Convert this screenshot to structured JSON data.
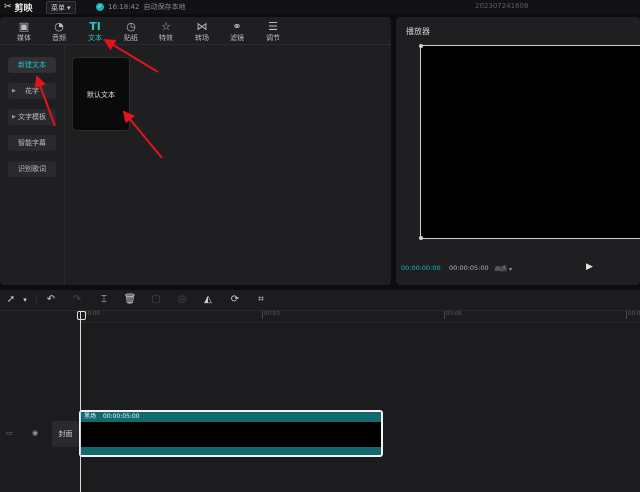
{
  "topbar": {
    "app_name": "剪映",
    "menu_label": "菜单",
    "save_time": "16:18:42",
    "save_text": "自动保存本地",
    "project_title": "202307241608"
  },
  "tabs": [
    {
      "label": "媒体",
      "icon": "media-icon"
    },
    {
      "label": "音频",
      "icon": "audio-icon"
    },
    {
      "label": "文本",
      "icon": "text-icon"
    },
    {
      "label": "贴纸",
      "icon": "sticker-icon"
    },
    {
      "label": "特效",
      "icon": "effects-icon"
    },
    {
      "label": "转场",
      "icon": "transition-icon"
    },
    {
      "label": "滤镜",
      "icon": "filter-icon"
    },
    {
      "label": "调节",
      "icon": "adjust-icon"
    }
  ],
  "text_menu": {
    "new_text": "新建文本",
    "fancy_text": "花字",
    "text_template": "文字模板",
    "smart_subtitle": "智能字幕",
    "lyrics": "识别歌词"
  },
  "default_text_card": "默认文本",
  "player": {
    "title": "播放器",
    "current_time": "00:00:00:00",
    "total_time": "00:00:05:00",
    "ratio_label": "画质"
  },
  "timeline": {
    "ticks": [
      "00:00",
      "00:03",
      "00:06",
      "00:0"
    ],
    "cover_label": "封面",
    "clip_name": "黑场",
    "clip_duration": "00:00:05:00"
  },
  "colors": {
    "accent": "#1ec9c9",
    "clip_header": "#136a6e",
    "annotation_arrow": "#e0141b"
  }
}
